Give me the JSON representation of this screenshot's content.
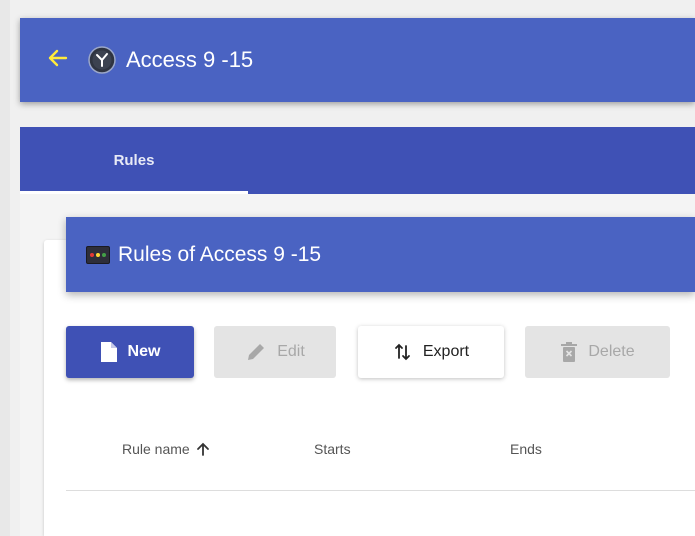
{
  "app": {
    "title": "Access 9 -15"
  },
  "tabs": [
    {
      "label": "Rules",
      "active": true
    }
  ],
  "card": {
    "title": "Rules of Access 9 -15"
  },
  "toolbar": {
    "new_label": "New",
    "edit_label": "Edit",
    "export_label": "Export",
    "delete_label": "Delete"
  },
  "table": {
    "columns": [
      "Rule name",
      "Starts",
      "Ends"
    ],
    "sorted_column": "Rule name",
    "sort_direction": "ascending",
    "rows": []
  },
  "colors": {
    "primary": "#3f51b5",
    "topbar": "#4a63c2",
    "back_arrow": "#ffeb3b",
    "disabled_bg": "#e4e4e4"
  }
}
